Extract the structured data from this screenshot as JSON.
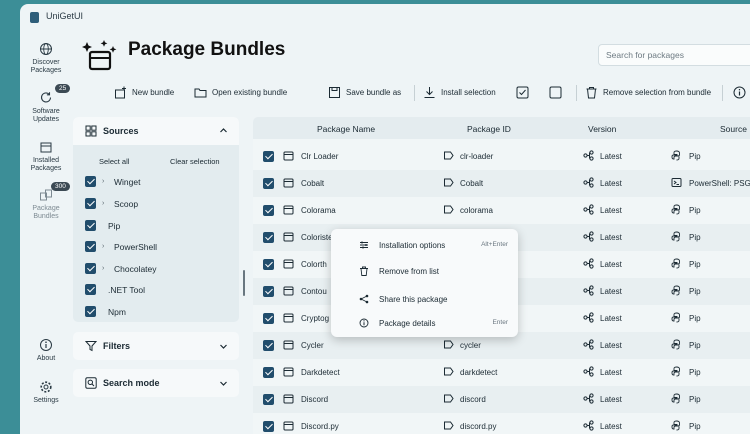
{
  "app": {
    "title": "UniGetUI"
  },
  "nav": {
    "discover": "Discover Packages",
    "updates": "Software Updates",
    "updates_badge": "25",
    "installed": "Installed Packages",
    "bundles": "Package Bundles",
    "bundles_badge": "300",
    "about": "About",
    "settings": "Settings"
  },
  "page": {
    "title": "Package Bundles"
  },
  "search": {
    "placeholder": "Search for packages"
  },
  "toolbar": {
    "new_bundle": "New bundle",
    "open_bundle": "Open existing bundle",
    "save_bundle": "Save bundle as",
    "install_selection": "Install selection",
    "remove_selection": "Remove selection from bundle"
  },
  "sources": {
    "title": "Sources",
    "select_all": "Select all",
    "clear_selection": "Clear selection",
    "items": [
      {
        "label": "Winget",
        "expandable": true
      },
      {
        "label": "Scoop",
        "expandable": true
      },
      {
        "label": "Pip",
        "expandable": false
      },
      {
        "label": "PowerShell",
        "expandable": true
      },
      {
        "label": "Chocolatey",
        "expandable": true
      },
      {
        "label": ".NET Tool",
        "expandable": false
      },
      {
        "label": "Npm",
        "expandable": false
      }
    ]
  },
  "filters": {
    "title": "Filters"
  },
  "search_mode": {
    "title": "Search mode"
  },
  "table": {
    "columns": [
      "Package Name",
      "Package ID",
      "Version",
      "Source"
    ],
    "rows": [
      {
        "name": "Clr Loader",
        "id": "clr-loader",
        "version": "Latest",
        "source": "Pip"
      },
      {
        "name": "Cobalt",
        "id": "Cobalt",
        "version": "Latest",
        "source": "PowerShell: PSGallery"
      },
      {
        "name": "Colorama",
        "id": "colorama",
        "version": "Latest",
        "source": "Pip"
      },
      {
        "name": "Coloriste",
        "id": "",
        "version": "Latest",
        "source": "Pip"
      },
      {
        "name": "Colorth",
        "id": "",
        "version": "Latest",
        "source": "Pip"
      },
      {
        "name": "Contou",
        "id": "",
        "version": "Latest",
        "source": "Pip"
      },
      {
        "name": "Cryptog",
        "id": "",
        "version": "Latest",
        "source": "Pip"
      },
      {
        "name": "Cycler",
        "id": "cycler",
        "version": "Latest",
        "source": "Pip"
      },
      {
        "name": "Darkdetect",
        "id": "darkdetect",
        "version": "Latest",
        "source": "Pip"
      },
      {
        "name": "Discord",
        "id": "discord",
        "version": "Latest",
        "source": "Pip"
      },
      {
        "name": "Discord.py",
        "id": "discord.py",
        "version": "Latest",
        "source": "Pip"
      }
    ]
  },
  "context_menu": {
    "items": [
      {
        "label": "Installation options",
        "shortcut": "Alt+Enter"
      },
      {
        "label": "Remove from list",
        "shortcut": ""
      },
      {
        "label": "Share this package",
        "shortcut": ""
      },
      {
        "label": "Package details",
        "shortcut": "Enter"
      }
    ]
  }
}
